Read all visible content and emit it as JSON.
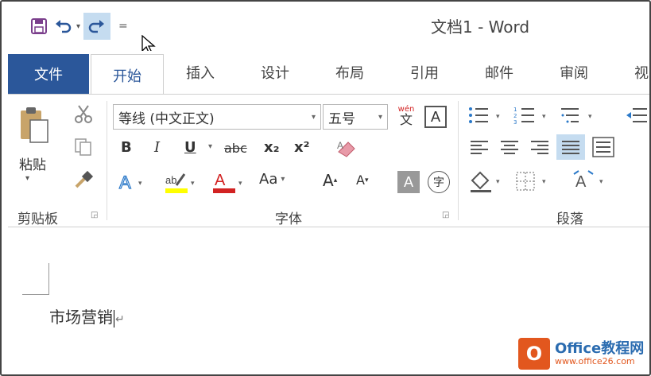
{
  "window": {
    "title": "文档1 - Word"
  },
  "qat": {
    "save_icon": "save-icon",
    "undo_icon": "undo-icon",
    "redo_icon": "redo-icon",
    "more": "="
  },
  "tabs": {
    "file": "文件",
    "home": "开始",
    "insert": "插入",
    "design": "设计",
    "layout": "布局",
    "references": "引用",
    "mailings": "邮件",
    "review": "审阅",
    "view": "视"
  },
  "clipboard": {
    "paste": "粘贴",
    "label": "剪贴板"
  },
  "font": {
    "name": "等线 (中文正文)",
    "size": "五号",
    "bold": "B",
    "italic": "I",
    "underline": "U",
    "strike": "abc",
    "subscript": "x₂",
    "superscript": "x²",
    "change_case": "Aa",
    "grow": "A",
    "shrink": "A",
    "phonetic_top": "wén",
    "phonetic_bottom": "文",
    "label": "字体"
  },
  "paragraph": {
    "label": "段落"
  },
  "document": {
    "text": "市场营销"
  },
  "watermark": {
    "title": "Office教程网",
    "url": "www.office26.com",
    "logo_letter": "O"
  },
  "colors": {
    "accent": "#2b579a",
    "highlight": "#ffff00",
    "font_color": "#d22222",
    "redo_bg": "#c5dcf0"
  }
}
